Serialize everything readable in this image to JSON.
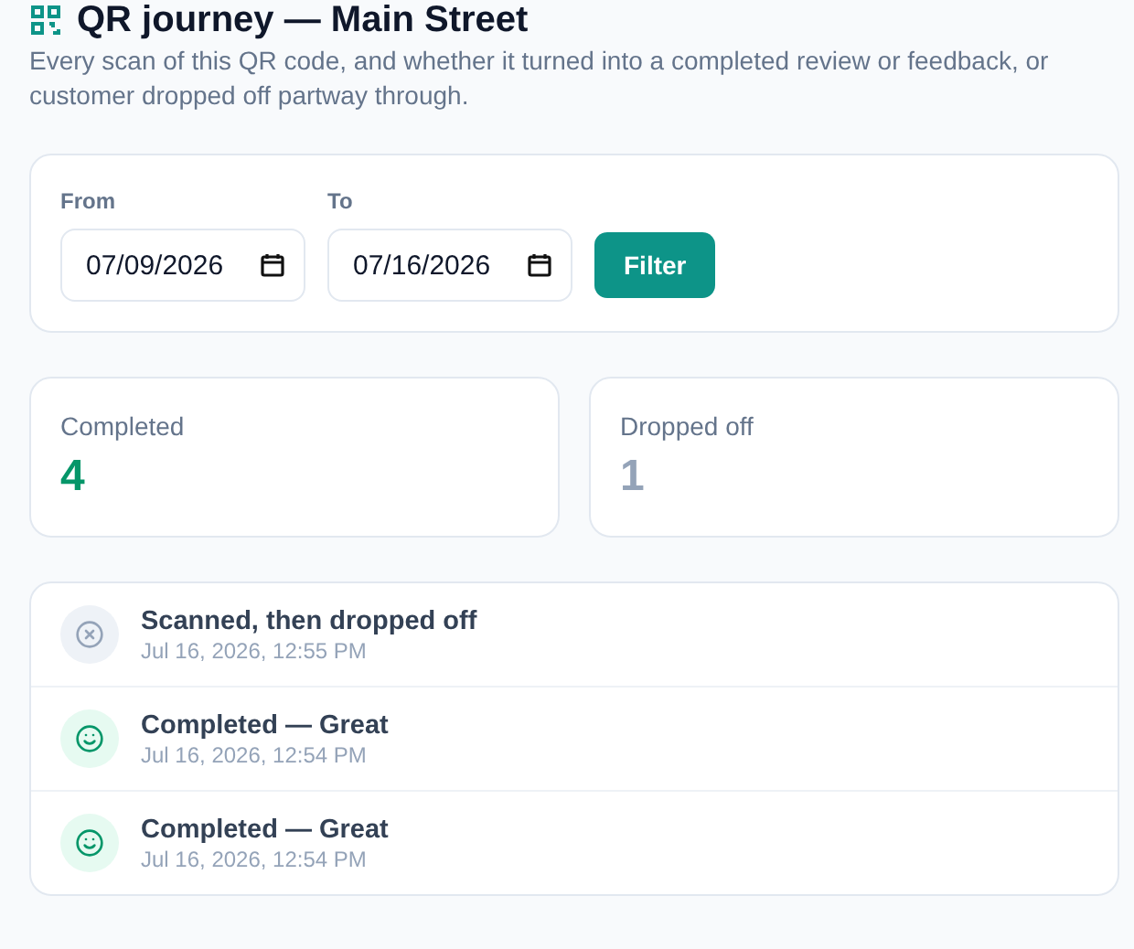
{
  "header": {
    "title": "QR journey — Main Street",
    "subtitle": "Every scan of this QR code, and whether it turned into a completed review or feedback, or customer dropped off partway through."
  },
  "filter": {
    "from": {
      "label": "From",
      "value": "07/09/2026"
    },
    "to": {
      "label": "To",
      "value": "07/16/2026"
    },
    "button": "Filter"
  },
  "stats": [
    {
      "label": "Completed",
      "value": "4",
      "kind": "completed"
    },
    {
      "label": "Dropped off",
      "value": "1",
      "kind": "dropped"
    }
  ],
  "events": [
    {
      "kind": "dropped",
      "title": "Scanned, then dropped off",
      "time": "Jul 16, 2026, 12:55 PM"
    },
    {
      "kind": "completed",
      "title": "Completed — Great",
      "time": "Jul 16, 2026, 12:54 PM"
    },
    {
      "kind": "completed",
      "title": "Completed — Great",
      "time": "Jul 16, 2026, 12:54 PM"
    }
  ]
}
